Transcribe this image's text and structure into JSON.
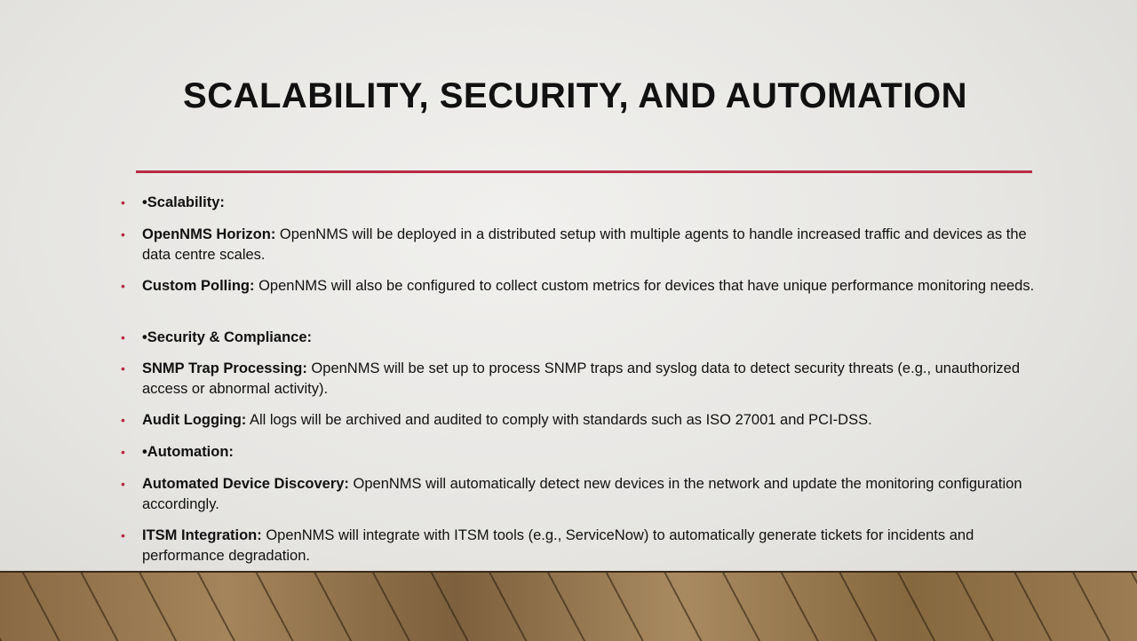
{
  "title": "SCALABILITY, SECURITY, AND AUTOMATION",
  "accent_color": "#b82a43",
  "items": [
    {
      "bold": "•Scalability:",
      "text": ""
    },
    {
      "bold": "OpenNMS Horizon:",
      "text": " OpenNMS will be deployed in a distributed setup with multiple agents to handle increased traffic and devices as the data centre scales."
    },
    {
      "bold": "Custom Polling:",
      "text": " OpenNMS will also be configured to collect custom metrics for devices that have unique performance monitoring needs."
    },
    {
      "bold": "•Security & Compliance:",
      "text": ""
    },
    {
      "bold": "SNMP Trap Processing:",
      "text": " OpenNMS will be set up to process SNMP traps and syslog data to detect security threats (e.g., unauthorized access or abnormal activity)."
    },
    {
      "bold": "Audit Logging:",
      "text": " All logs will be archived and audited to comply with standards such as ISO 27001 and PCI-DSS."
    },
    {
      "bold": "•Automation:",
      "text": ""
    },
    {
      "bold": "Automated Device Discovery:",
      "text": " OpenNMS will automatically detect new devices in the network and update the monitoring configuration accordingly."
    },
    {
      "bold": "ITSM Integration:",
      "text": " OpenNMS will integrate with ITSM tools (e.g., ServiceNow) to automatically generate tickets for incidents and performance degradation."
    }
  ]
}
